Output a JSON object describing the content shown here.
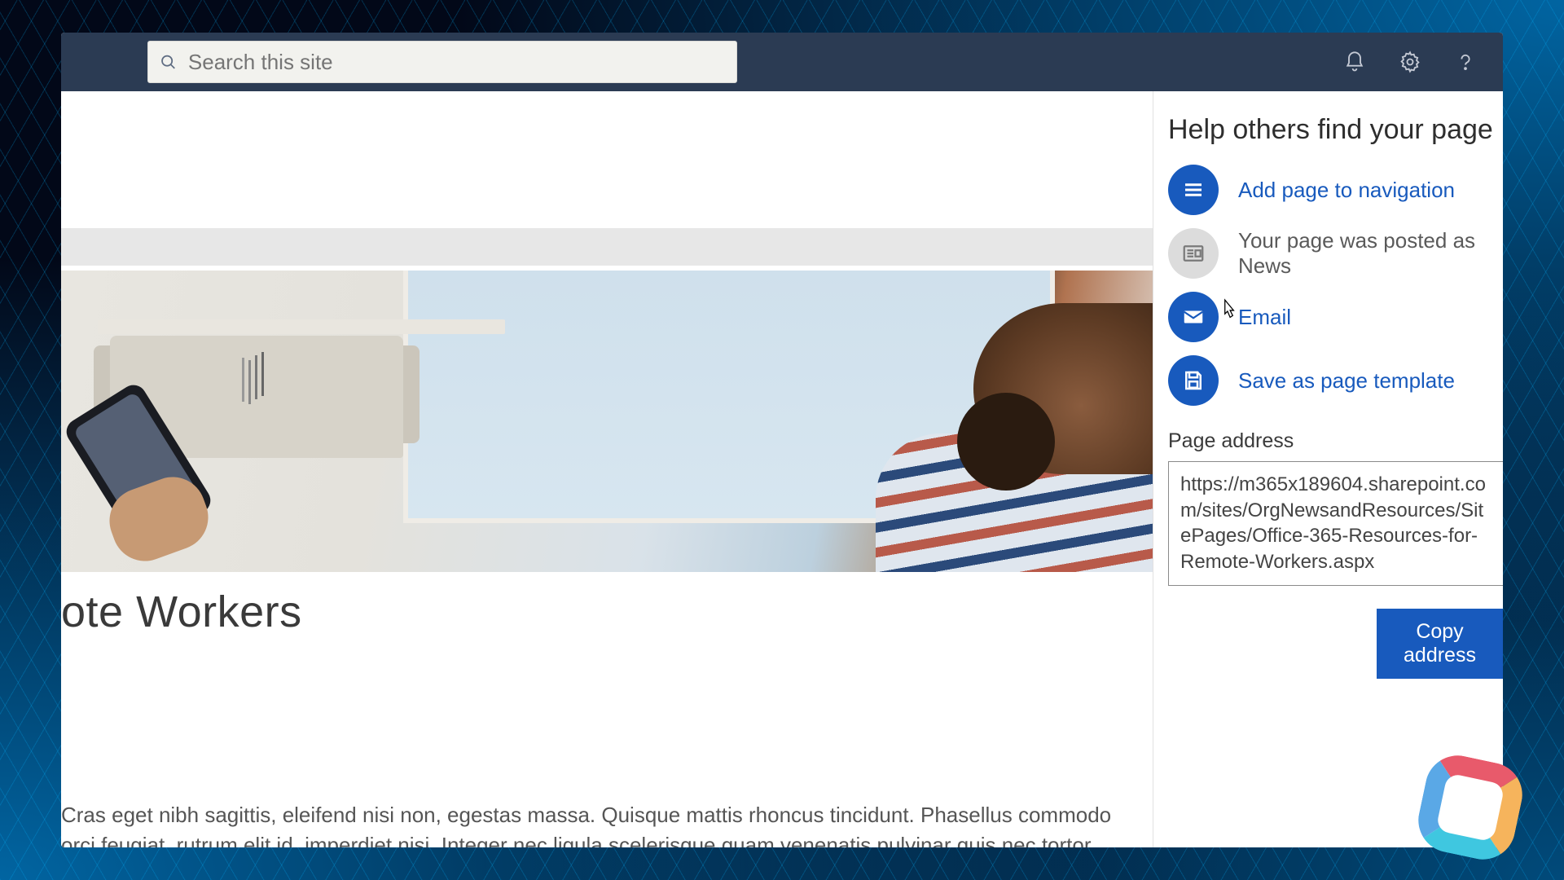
{
  "header": {
    "search_placeholder": "Search this site"
  },
  "page": {
    "title_fragment": "ote Workers",
    "body": "Cras eget nibh sagittis, eleifend nisi non, egestas massa. Quisque mattis rhoncus tincidunt. Phasellus commodo orci feugiat, rutrum elit id, imperdiet nisi. Integer nec ligula scelerisque quam venenatis pulvinar quis nec tortor."
  },
  "panel": {
    "title": "Help others find your page",
    "actions": {
      "add_nav": "Add page to navigation",
      "posted_news": "Your page was posted as News",
      "email": "Email",
      "save_template": "Save as page template"
    },
    "address_label": "Page address",
    "address_value": "https://m365x189604.sharepoint.com/sites/OrgNewsandResources/SitePages/Office-365-Resources-for-Remote-Workers.aspx",
    "copy_button": "Copy address"
  }
}
